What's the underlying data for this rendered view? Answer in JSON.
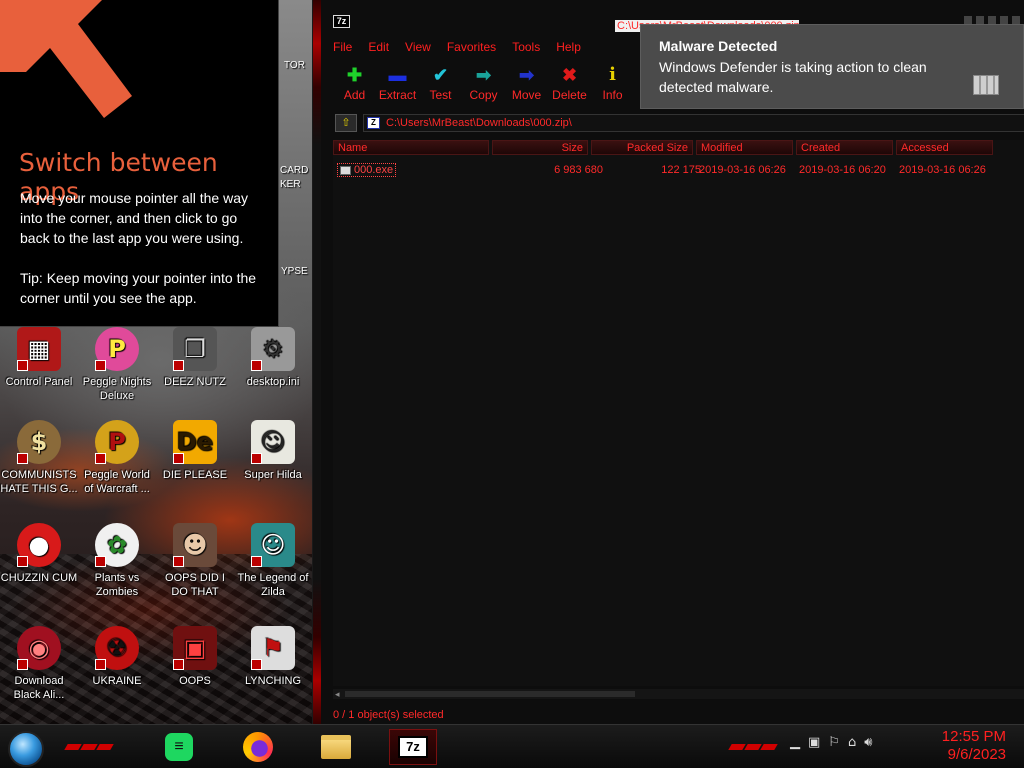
{
  "tip": {
    "title": "Switch between apps",
    "body1": "Move your mouse pointer all the way into the corner, and then click to go back to the last app you were using.",
    "body2": "Tip: Keep moving your pointer into the corner until you see the app.",
    "accent": "#e8603c"
  },
  "desktop": {
    "edge_labels": [
      "TOR",
      "CARD",
      "KER",
      "YPSE"
    ],
    "icons": [
      {
        "label": "Control Panel",
        "icon": "control-panel-icon",
        "color": "#b01818"
      },
      {
        "label": "Peggle Nights Deluxe",
        "icon": "peggle-icon",
        "color": "#e04a9a"
      },
      {
        "label": "DEEZ NUTZ",
        "icon": "folder-shortcut-icon",
        "color": "#555"
      },
      {
        "label": "desktop.ini",
        "icon": "settings-file-icon",
        "color": "#999"
      },
      {
        "label": "COMMUNISTS HATE THIS G...",
        "icon": "money-bag-icon",
        "color": "#8a6a3a"
      },
      {
        "label": "Peggle World of Warcraft ...",
        "icon": "peggle-icon",
        "color": "#d4a21a"
      },
      {
        "label": "DIE PLEASE",
        "icon": "de-icon",
        "color": "#f2a900"
      },
      {
        "label": "Super Hilda",
        "icon": "hilda-icon",
        "color": "#e8e8e0"
      },
      {
        "label": "CHUZZIN CUM",
        "icon": "chuzzle-icon",
        "color": "#d81a1a"
      },
      {
        "label": "Plants vs Zombies",
        "icon": "flower-icon",
        "color": "#f0f0f0"
      },
      {
        "label": "OOPS DID I DO THAT",
        "icon": "portrait-icon",
        "color": "#6a4a3a"
      },
      {
        "label": "The Legend of Zilda",
        "icon": "zilda-icon",
        "color": "#2a8a8a"
      },
      {
        "label": "Download Black Ali...",
        "icon": "red-orb-icon",
        "color": "#a01020"
      },
      {
        "label": "UKRAINE",
        "icon": "radiation-icon",
        "color": "#c01010"
      },
      {
        "label": "OOPS",
        "icon": "red-frame-icon",
        "color": "#701010"
      },
      {
        "label": "LYNCHING",
        "icon": "flag-icon",
        "color": "#dddddd"
      }
    ]
  },
  "zip": {
    "title": "C:\\Users\\MrBeast\\Downloads\\000.zip\\",
    "title_icon": "7z",
    "menu": [
      "File",
      "Edit",
      "View",
      "Favorites",
      "Tools",
      "Help"
    ],
    "toolbar": [
      {
        "label": "Add",
        "icon": "plus-icon",
        "glyph": "✚",
        "color": "#1fd12b"
      },
      {
        "label": "Extract",
        "icon": "minus-icon",
        "glyph": "▬",
        "color": "#1c2fe0"
      },
      {
        "label": "Test",
        "icon": "check-icon",
        "glyph": "✔",
        "color": "#22c4d8"
      },
      {
        "label": "Copy",
        "icon": "copy-arrow-icon",
        "glyph": "➡",
        "color": "#1aa39a"
      },
      {
        "label": "Move",
        "icon": "move-arrow-icon",
        "glyph": "➡",
        "color": "#2233cc"
      },
      {
        "label": "Delete",
        "icon": "delete-x-icon",
        "glyph": "✖",
        "color": "#e01a1a"
      },
      {
        "label": "Info",
        "icon": "info-icon",
        "glyph": "i",
        "color": "#e6d000"
      }
    ],
    "address": "C:\\Users\\MrBeast\\Downloads\\000.zip\\",
    "columns": [
      "Name",
      "Size",
      "Packed Size",
      "Modified",
      "Created",
      "Accessed"
    ],
    "files": [
      {
        "name": "000.exe",
        "size": "6 983 680",
        "packed": "122 175",
        "modified": "2019-03-16 06:26",
        "created": "2019-03-16 06:20",
        "accessed": "2019-03-16 06:26"
      }
    ],
    "status": "0 / 1 object(s) selected",
    "accent": "#ff2a2a"
  },
  "toast": {
    "title": "Malware Detected",
    "body": "Windows Defender is taking action to clean detected malware."
  },
  "taskbar": {
    "apps": [
      {
        "name": "Spotify",
        "icon": "spotify-icon"
      },
      {
        "name": "Firefox",
        "icon": "firefox-icon"
      },
      {
        "name": "File Explorer",
        "icon": "folder-icon"
      },
      {
        "name": "7-Zip",
        "icon": "7zip-icon",
        "glyph": "7z"
      }
    ],
    "time": "12:55 PM",
    "date": "9/6/2023"
  }
}
